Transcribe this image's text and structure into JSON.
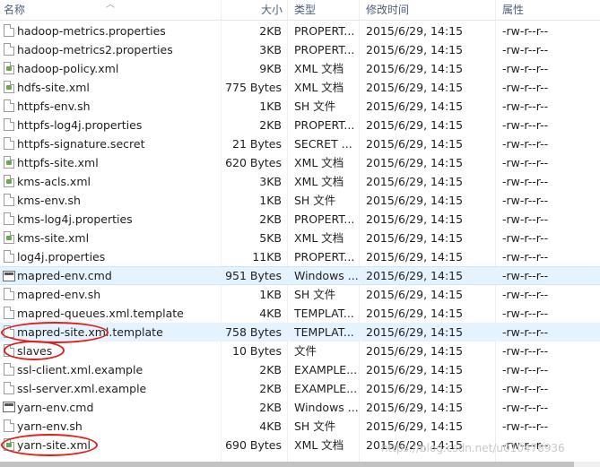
{
  "columns": {
    "name": "名称",
    "size": "大小",
    "type": "类型",
    "modified": "修改时间",
    "attr": "属性"
  },
  "files": [
    {
      "name": "hadoop-metrics.properties",
      "size": "2KB",
      "type": "PROPERT...",
      "date": "2015/6/29, 14:15",
      "attr": "-rw-r--r--",
      "icon": "file"
    },
    {
      "name": "hadoop-metrics2.properties",
      "size": "3KB",
      "type": "PROPERT...",
      "date": "2015/6/29, 14:15",
      "attr": "-rw-r--r--",
      "icon": "file"
    },
    {
      "name": "hadoop-policy.xml",
      "size": "9KB",
      "type": "XML 文档",
      "date": "2015/6/29, 14:15",
      "attr": "-rw-r--r--",
      "icon": "xml"
    },
    {
      "name": "hdfs-site.xml",
      "size": "775 Bytes",
      "type": "XML 文档",
      "date": "2015/6/29, 14:15",
      "attr": "-rw-r--r--",
      "icon": "xml"
    },
    {
      "name": "httpfs-env.sh",
      "size": "1KB",
      "type": "SH 文件",
      "date": "2015/6/29, 14:15",
      "attr": "-rw-r--r--",
      "icon": "file"
    },
    {
      "name": "httpfs-log4j.properties",
      "size": "2KB",
      "type": "PROPERT...",
      "date": "2015/6/29, 14:15",
      "attr": "-rw-r--r--",
      "icon": "file"
    },
    {
      "name": "httpfs-signature.secret",
      "size": "21 Bytes",
      "type": "SECRET ...",
      "date": "2015/6/29, 14:15",
      "attr": "-rw-r--r--",
      "icon": "file"
    },
    {
      "name": "httpfs-site.xml",
      "size": "620 Bytes",
      "type": "XML 文档",
      "date": "2015/6/29, 14:15",
      "attr": "-rw-r--r--",
      "icon": "xml"
    },
    {
      "name": "kms-acls.xml",
      "size": "3KB",
      "type": "XML 文档",
      "date": "2015/6/29, 14:15",
      "attr": "-rw-r--r--",
      "icon": "xml"
    },
    {
      "name": "kms-env.sh",
      "size": "1KB",
      "type": "SH 文件",
      "date": "2015/6/29, 14:15",
      "attr": "-rw-r--r--",
      "icon": "file"
    },
    {
      "name": "kms-log4j.properties",
      "size": "2KB",
      "type": "PROPERT...",
      "date": "2015/6/29, 14:15",
      "attr": "-rw-r--r--",
      "icon": "file"
    },
    {
      "name": "kms-site.xml",
      "size": "5KB",
      "type": "XML 文档",
      "date": "2015/6/29, 14:15",
      "attr": "-rw-r--r--",
      "icon": "xml"
    },
    {
      "name": "log4j.properties",
      "size": "11KB",
      "type": "PROPERT...",
      "date": "2015/6/29, 14:15",
      "attr": "-rw-r--r--",
      "icon": "file"
    },
    {
      "name": "mapred-env.cmd",
      "size": "951 Bytes",
      "type": "Windows ...",
      "date": "2015/6/29, 14:15",
      "attr": "-rw-r--r--",
      "icon": "cmd",
      "state": "sel"
    },
    {
      "name": "mapred-env.sh",
      "size": "1KB",
      "type": "SH 文件",
      "date": "2015/6/29, 14:15",
      "attr": "-rw-r--r--",
      "icon": "file"
    },
    {
      "name": "mapred-queues.xml.template",
      "size": "4KB",
      "type": "TEMPLAT...",
      "date": "2015/6/29, 14:15",
      "attr": "-rw-r--r--",
      "icon": "file"
    },
    {
      "name": "mapred-site.xml.template",
      "size": "758 Bytes",
      "type": "TEMPLAT...",
      "date": "2015/6/29, 14:15",
      "attr": "-rw-r--r--",
      "icon": "file",
      "state": "hover"
    },
    {
      "name": "slaves",
      "size": "10 Bytes",
      "type": "文件",
      "date": "2015/6/29, 14:15",
      "attr": "-rw-r--r--",
      "icon": "file"
    },
    {
      "name": "ssl-client.xml.example",
      "size": "2KB",
      "type": "EXAMPLE...",
      "date": "2015/6/29, 14:15",
      "attr": "-rw-r--r--",
      "icon": "file"
    },
    {
      "name": "ssl-server.xml.example",
      "size": "2KB",
      "type": "EXAMPLE...",
      "date": "2015/6/29, 14:15",
      "attr": "-rw-r--r--",
      "icon": "file"
    },
    {
      "name": "yarn-env.cmd",
      "size": "2KB",
      "type": "Windows ...",
      "date": "2015/6/29, 14:15",
      "attr": "-rw-r--r--",
      "icon": "cmd"
    },
    {
      "name": "yarn-env.sh",
      "size": "4KB",
      "type": "SH 文件",
      "date": "2015/6/29, 14:15",
      "attr": "-rw-r--r--",
      "icon": "file"
    },
    {
      "name": "yarn-site.xml",
      "size": "690 Bytes",
      "type": "XML 文档",
      "date": "2015/6/29, 14:15",
      "attr": "-rw-r--r--",
      "icon": "xml"
    }
  ],
  "watermark": "https://blog.csdn.net/u010478936",
  "colors": {
    "selection": "#e5f3ff",
    "annotation": "#e0201b",
    "header_text": "#4c607a"
  }
}
